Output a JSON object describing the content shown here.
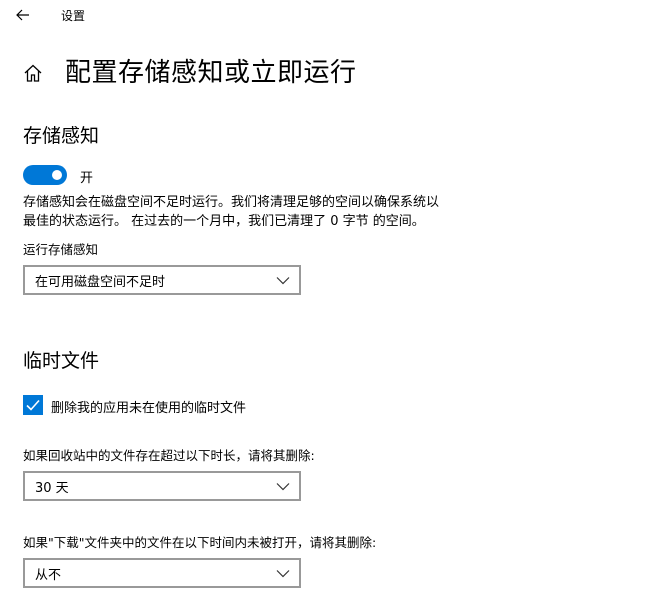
{
  "titlebar": {
    "back_icon": "back-arrow-icon",
    "title": "设置"
  },
  "header": {
    "home_icon": "home-icon",
    "title": "配置存储感知或立即运行"
  },
  "storage_sense": {
    "heading": "存储感知",
    "toggle_label": "开",
    "toggle_on": true,
    "description_line1": "存储感知会在磁盘空间不足时运行。我们将清理足够的空间以确保系统以",
    "description_line2": "最佳的状态运行。 在过去的一个月中，我们已清理了 0 字节 的空间。",
    "run_label": "运行存储感知",
    "run_value": "在可用磁盘空间不足时"
  },
  "temp_files": {
    "heading": "临时文件",
    "delete_temp_label": "删除我的应用未在使用的临时文件",
    "delete_temp_checked": true,
    "recycle_label": "如果回收站中的文件存在超过以下时长，请将其删除:",
    "recycle_value": "30 天",
    "downloads_label": "如果\"下载\"文件夹中的文件在以下时间内未被打开，请将其删除:",
    "downloads_value": "从不"
  },
  "colors": {
    "accent": "#0078d7",
    "border": "#999999"
  }
}
